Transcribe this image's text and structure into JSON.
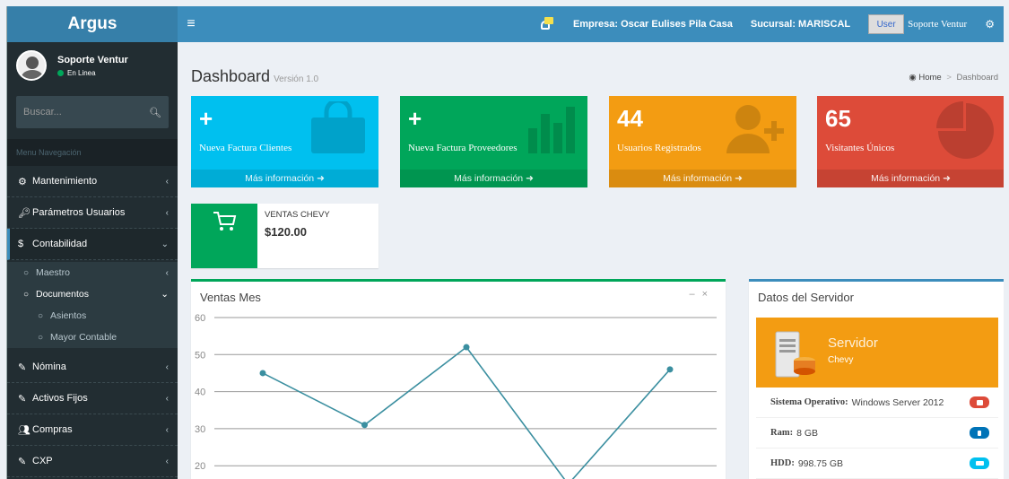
{
  "app": {
    "name": "Argus"
  },
  "header": {
    "empresa": "Empresa: Oscar Eulises Pila Casa",
    "sucursal": "Sucursal: MARISCAL",
    "user_img_alt": "User",
    "user_name": "Soporte Ventur"
  },
  "sidebar": {
    "user": {
      "name": "Soporte Ventur",
      "status": "En Linea"
    },
    "search_placeholder": "Buscar...",
    "menu_header": "Menu Navegación",
    "items": [
      {
        "label": "Mantenimiento",
        "icon": "dashboard-icon"
      },
      {
        "label": "Parámetros Usuarios",
        "icon": "key-icon"
      },
      {
        "label": "Contabilidad",
        "icon": "dollar-icon"
      }
    ],
    "sub_items": [
      {
        "label": "Maestro"
      },
      {
        "label": "Documentos"
      }
    ],
    "sub_sub_items": [
      {
        "label": "Asientos"
      },
      {
        "label": "Mayor Contable"
      }
    ],
    "items_after": [
      {
        "label": "Nómina",
        "icon": "edit-icon"
      },
      {
        "label": "Activos Fijos",
        "icon": "edit-icon"
      },
      {
        "label": "Compras",
        "icon": "users-icon"
      },
      {
        "label": "CXP",
        "icon": "edit-icon"
      }
    ]
  },
  "page": {
    "title": "Dashboard",
    "version": "Versión 1.0",
    "breadcrumb": {
      "home": "Home",
      "current": "Dashboard"
    }
  },
  "boxes": [
    {
      "value": "+",
      "label": "Nueva Factura Clientes",
      "more": "Más información",
      "color": "#00c0ef",
      "icon": "shopping-bag-icon"
    },
    {
      "value": "+",
      "label": "Nueva Factura Proveedores",
      "more": "Más información",
      "color": "#00a65a",
      "icon": "bar-chart-icon"
    },
    {
      "value": "44",
      "label": "Usuarios Registrados",
      "more": "Más información",
      "color": "#f39c12",
      "icon": "user-plus-icon"
    },
    {
      "value": "65",
      "label": "Visitantes Únicos",
      "more": "Más información",
      "color": "#dd4b39",
      "icon": "pie-chart-icon"
    }
  ],
  "sales_box": {
    "label": "VENTAS CHEVY",
    "value": "$120.00",
    "icon": "cart-icon"
  },
  "chart_panel": {
    "title": "Ventas Mes"
  },
  "chart_data": {
    "type": "line",
    "title": "Ventas Mes",
    "y_ticks": [
      "60",
      "50",
      "40",
      "30",
      "20"
    ],
    "ylim": [
      20,
      60
    ],
    "grid": true,
    "values": [
      45,
      31,
      52,
      15,
      46
    ],
    "color": "#3b8fa0"
  },
  "server_panel": {
    "title": "Datos del Servidor",
    "head_title": "Servidor",
    "head_sub": "Chevy",
    "rows": [
      {
        "label": "Sistema Operativo:",
        "value": "Windows Server 2012",
        "badge_color": "#dd4b39",
        "icon": "windows-icon"
      },
      {
        "label": "Ram:",
        "value": "8 GB",
        "badge_color": "#0073b7",
        "icon": "memory-icon"
      },
      {
        "label": "HDD:",
        "value": "998.75 GB",
        "badge_color": "#00c0ef",
        "icon": "hdd-icon"
      }
    ]
  }
}
